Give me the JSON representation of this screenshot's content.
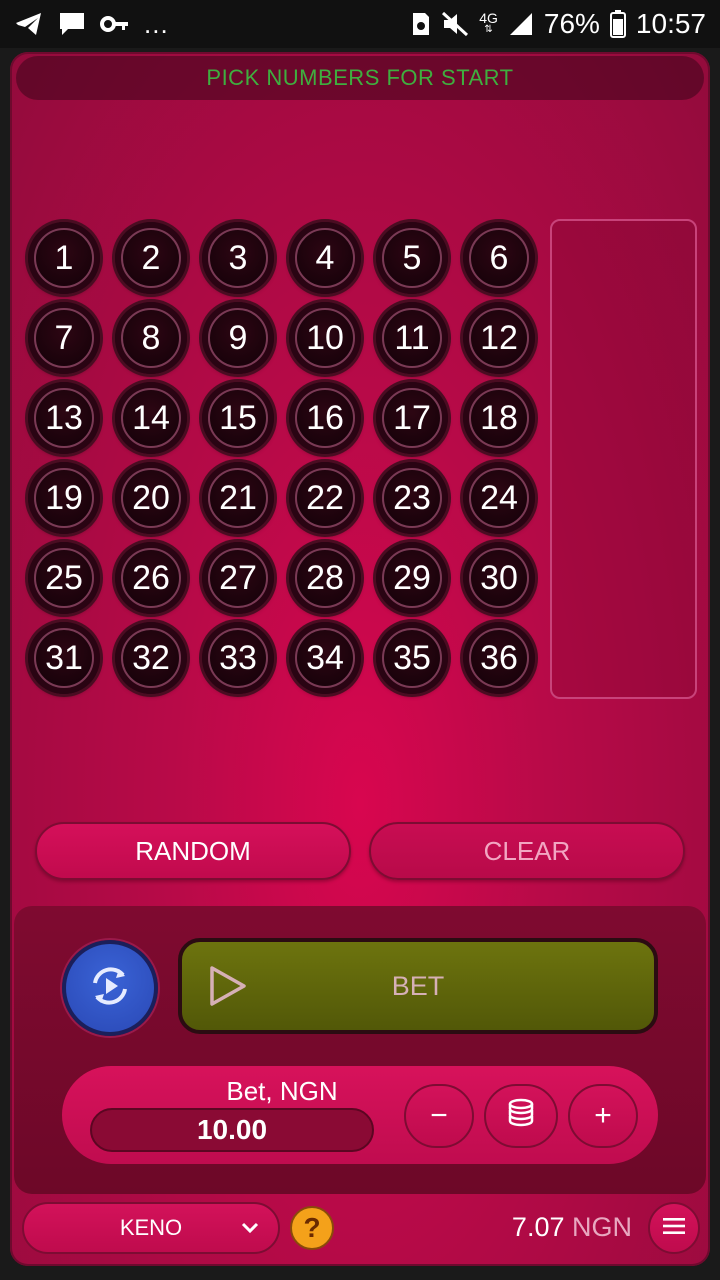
{
  "status_bar": {
    "icons": [
      "telegram-icon",
      "message-icon",
      "key-icon"
    ],
    "more": "...",
    "right_icons": [
      "sim-icon",
      "mute-icon",
      "network-4g-icon",
      "signal-icon"
    ],
    "network": "4G",
    "battery": "76%",
    "time": "10:57"
  },
  "header": {
    "title": "PICK NUMBERS FOR START"
  },
  "numbers": [
    "1",
    "2",
    "3",
    "4",
    "5",
    "6",
    "7",
    "8",
    "9",
    "10",
    "11",
    "12",
    "13",
    "14",
    "15",
    "16",
    "17",
    "18",
    "19",
    "20",
    "21",
    "22",
    "23",
    "24",
    "25",
    "26",
    "27",
    "28",
    "29",
    "30",
    "31",
    "32",
    "33",
    "34",
    "35",
    "36"
  ],
  "actions": {
    "random_label": "RANDOM",
    "clear_label": "CLEAR"
  },
  "bet": {
    "button_label": "BET",
    "stake_label": "Bet, NGN",
    "stake_value": "10.00",
    "minus_label": "−",
    "plus_label": "+"
  },
  "footer": {
    "game_name": "KENO",
    "help_label": "?",
    "balance_value": "7.07",
    "balance_currency": "NGN"
  },
  "colors": {
    "background": "#b80a48",
    "header_text": "#3fae3f",
    "bet_button": "#6d740e",
    "autoplay_button": "#2a48b5",
    "help_button": "#f4a11a"
  }
}
